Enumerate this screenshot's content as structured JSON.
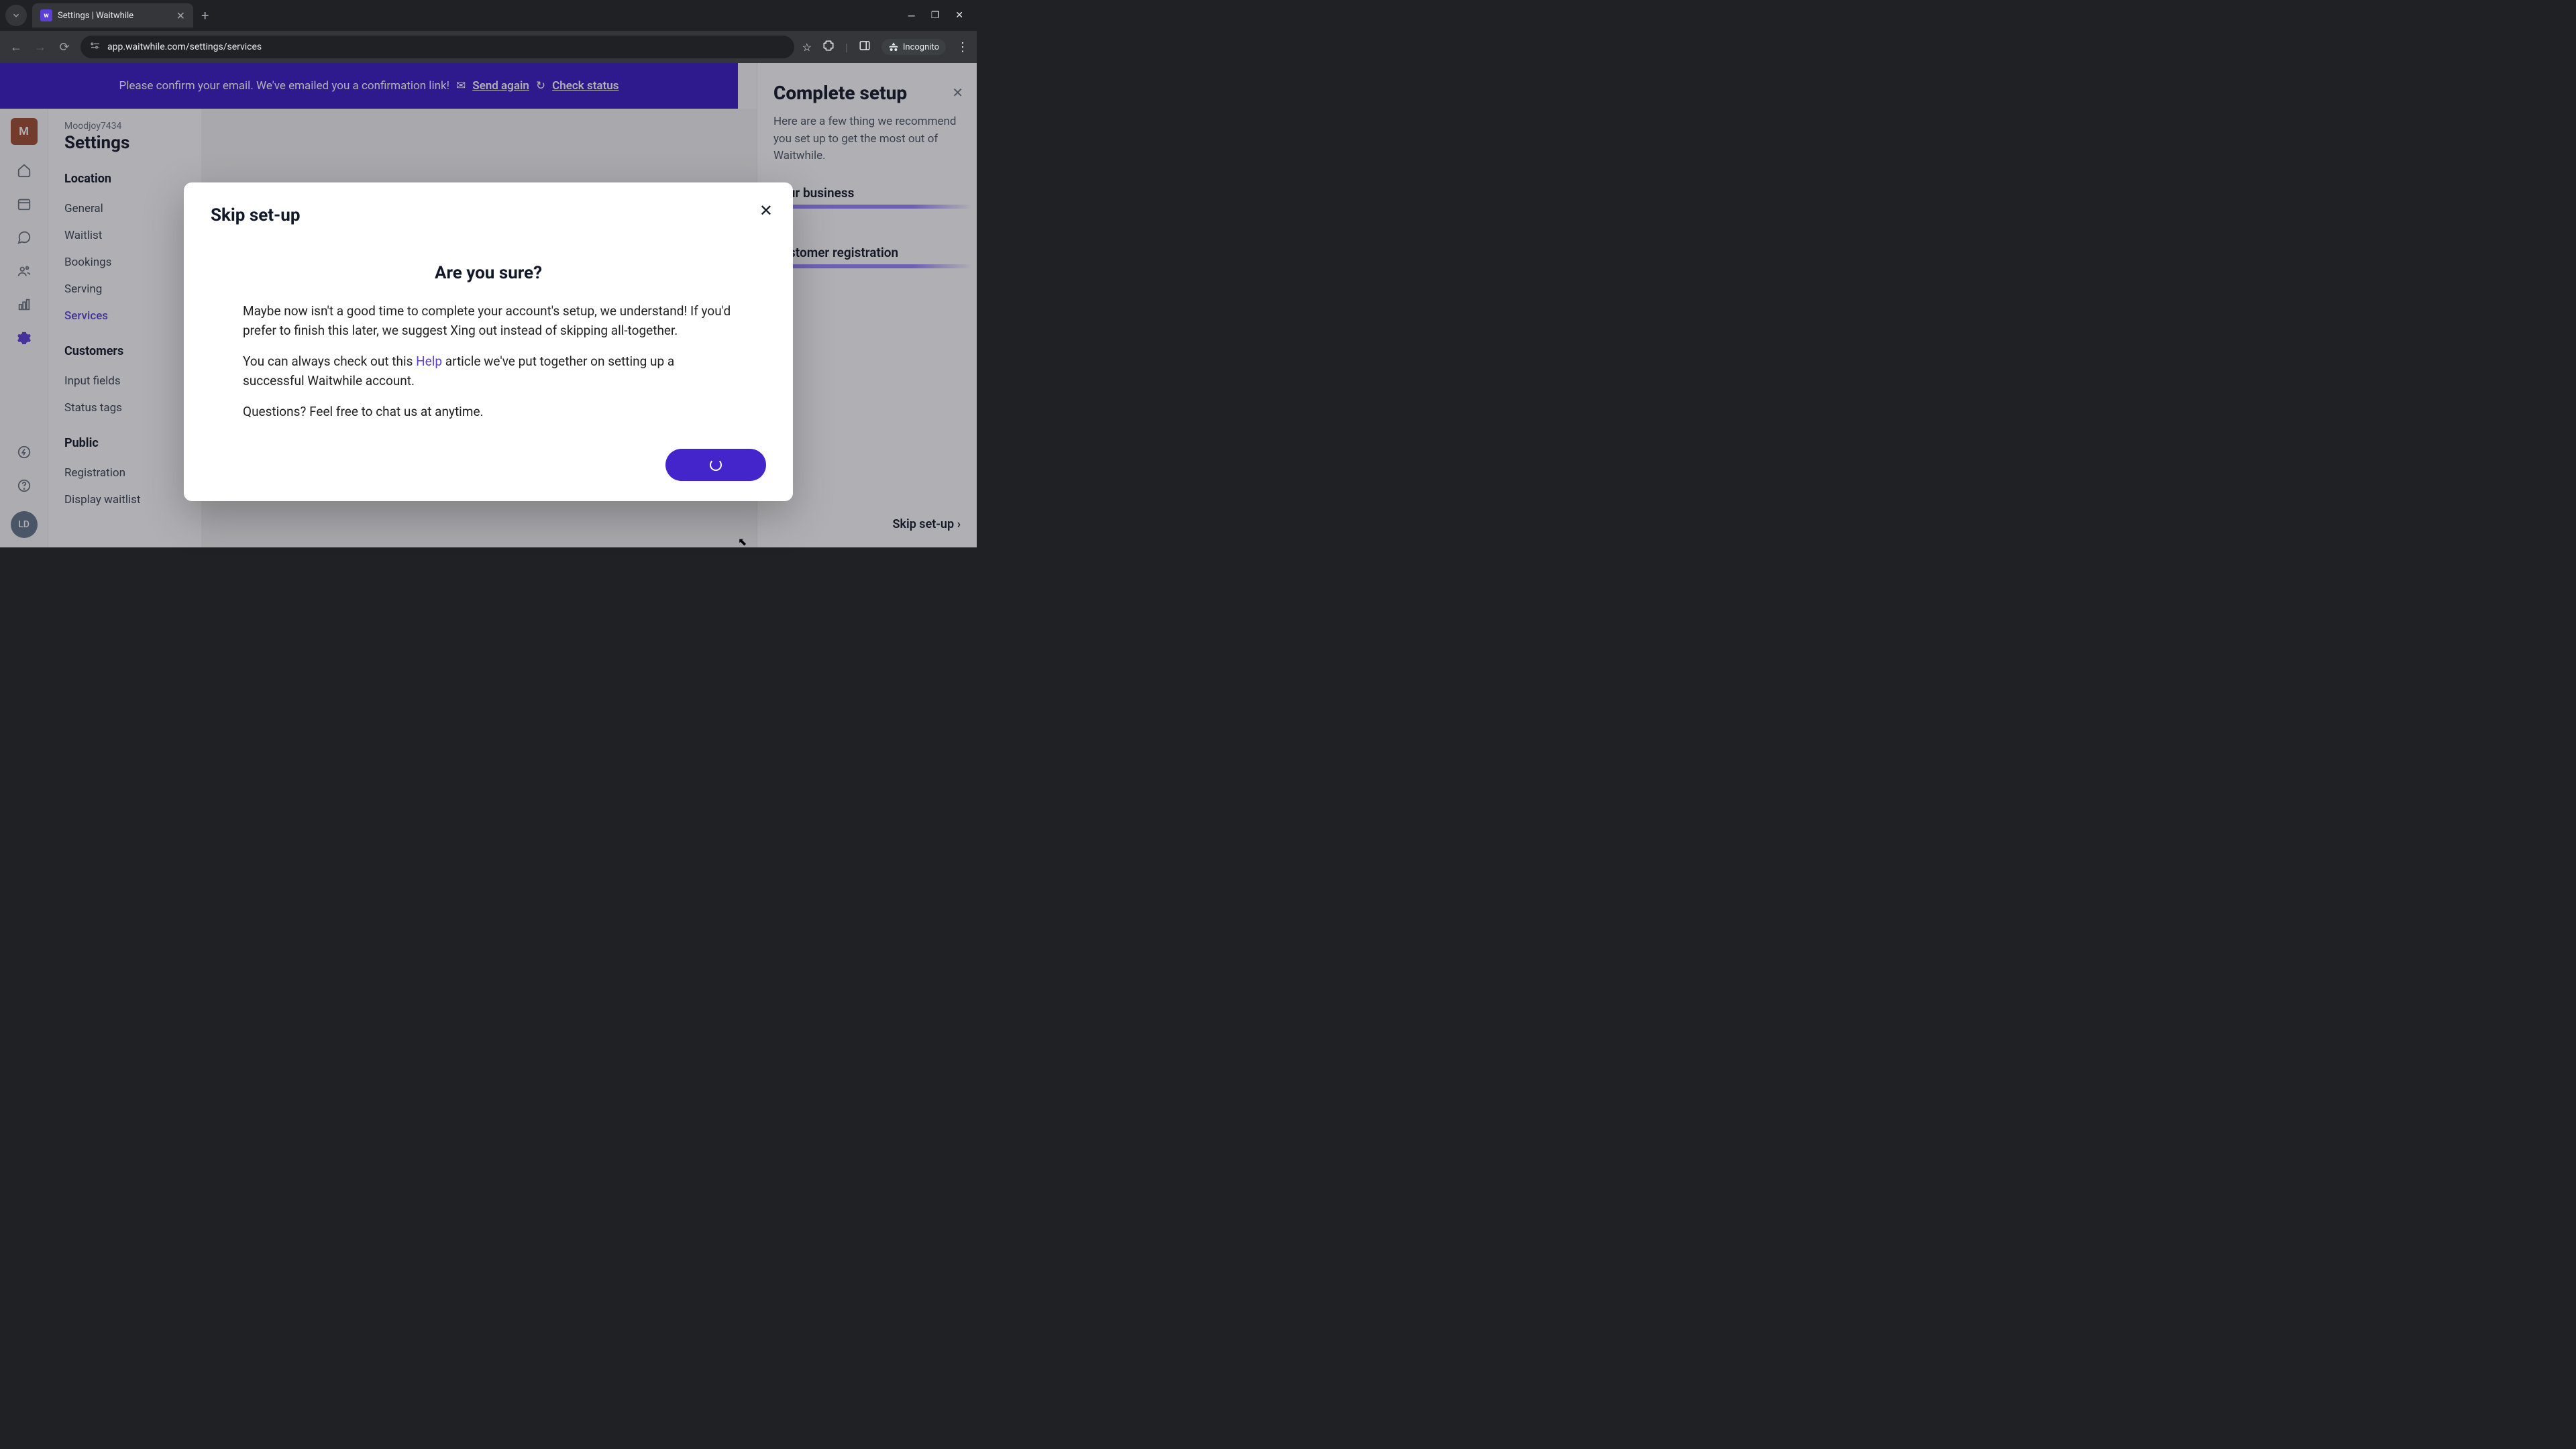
{
  "browser": {
    "tab_title": "Settings | Waitwhile",
    "url": "app.waitwhile.com/settings/services",
    "incognito_label": "Incognito"
  },
  "banner": {
    "text": "Please confirm your email. We've emailed you a confirmation link!",
    "send_again": "Send again",
    "check_status": "Check status"
  },
  "rail": {
    "logo_initial": "M",
    "avatar_initials": "LD"
  },
  "sidebar": {
    "org": "Moodjoy7434",
    "title": "Settings",
    "sections": [
      {
        "label": "Location",
        "items": [
          "General",
          "Waitlist",
          "Bookings",
          "Serving",
          "Services"
        ]
      },
      {
        "label": "Customers",
        "items": [
          "Input fields",
          "Status tags"
        ]
      },
      {
        "label": "Public",
        "items": [
          "Registration",
          "Display waitlist"
        ]
      }
    ],
    "active_item": "Services"
  },
  "setup_panel": {
    "title": "Complete setup",
    "subtitle": "Here are a few thing we recommend you set up to get the most out of Waitwhile.",
    "cards": [
      "Your business",
      "Customer registration"
    ],
    "skip_label": "Skip set-up"
  },
  "modal": {
    "title": "Skip set-up",
    "heading": "Are you sure?",
    "p1": "Maybe now isn't a good time to complete your account's setup, we understand! If you'd prefer to finish this later, we suggest Xing out instead of skipping all-together.",
    "p2_pre": "You can always check out this ",
    "p2_link": "Help",
    "p2_post": " article we've put together on setting up a successful Waitwhile account.",
    "p3": "Questions? Feel free to chat us at anytime."
  }
}
